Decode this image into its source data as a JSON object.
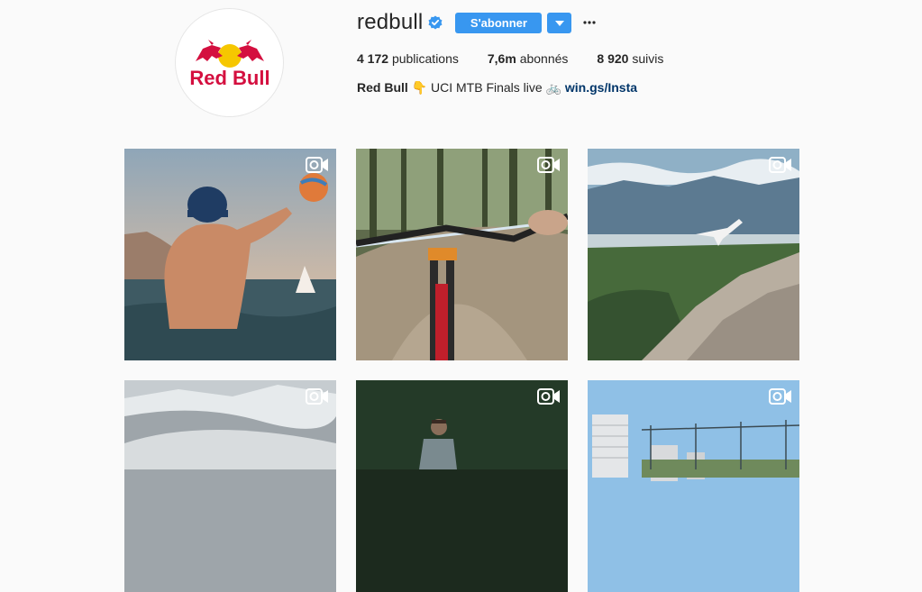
{
  "profile": {
    "username": "redbull",
    "avatar_logo_text": "Red Bull",
    "follow_label": "S'abonner",
    "stats": {
      "posts_count": "4 172",
      "posts_label": "publications",
      "followers_count": "7,6m",
      "followers_label": "abonnés",
      "following_count": "8 920",
      "following_label": "suivis"
    },
    "bio": {
      "name": "Red Bull",
      "emoji1": "👇",
      "text": "UCI MTB Finals live",
      "emoji2": "🚲",
      "link": "win.gs/Insta"
    }
  },
  "colors": {
    "accent": "#3897f0",
    "link": "#003569",
    "verified": "#3897f0",
    "brand_red": "#d40f3f",
    "brand_yellow": "#f6c700",
    "brand_navy": "#1c2a5c"
  },
  "icons": {
    "verified": "verified-badge-icon",
    "dropdown": "chevron-down-icon",
    "more": "more-options-icon",
    "post_type": "video-icon"
  },
  "posts": [
    {
      "type": "video",
      "scene": "water-polo player in sea"
    },
    {
      "type": "video",
      "scene": "mountain bike POV in forest"
    },
    {
      "type": "video",
      "scene": "plane over mountain ridge"
    },
    {
      "type": "video",
      "scene": "snowy mountain slope"
    },
    {
      "type": "video",
      "scene": "rider in dark forest"
    },
    {
      "type": "video",
      "scene": "city buildings and sky"
    }
  ]
}
